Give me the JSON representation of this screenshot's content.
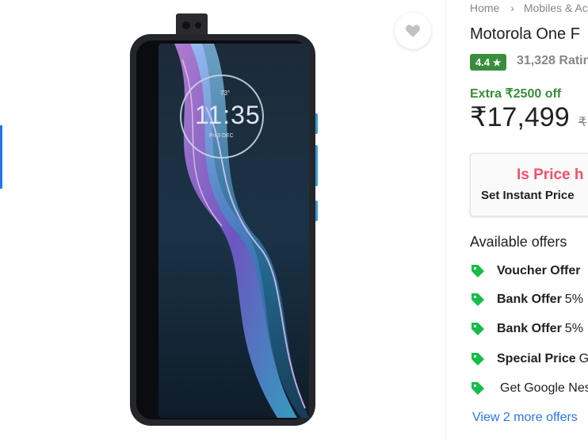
{
  "breadcrumb": [
    "Home",
    "Mobiles & Ac"
  ],
  "product": {
    "title": "Motorola One F",
    "rating": "4.4",
    "rating_star": "★",
    "rating_count": "31,328 Ratin",
    "extra_off": "Extra ₹2500 off",
    "price": "₹17,499",
    "mrp": "₹"
  },
  "phone_screen": {
    "temperature": "73°",
    "time": "11:35",
    "date": "Fri 3 DEC"
  },
  "price_alert": {
    "headline": "Is Price h",
    "subline": "Set Instant Price"
  },
  "offers": {
    "heading": "Available offers",
    "items": [
      {
        "type": "Voucher Offer",
        "text": ""
      },
      {
        "type": "Bank Offer",
        "text": "5%"
      },
      {
        "type": "Bank Offer",
        "text": "5%"
      },
      {
        "type": "Special Price",
        "text": "G"
      },
      {
        "type": "",
        "text": "Get Google Nes"
      }
    ],
    "more_link": "View 2 more offers"
  },
  "colors": {
    "accent": "#2874f0",
    "rating_green": "#388e3c",
    "alert_pink": "#f2506b",
    "tag_green": "#14be47"
  }
}
